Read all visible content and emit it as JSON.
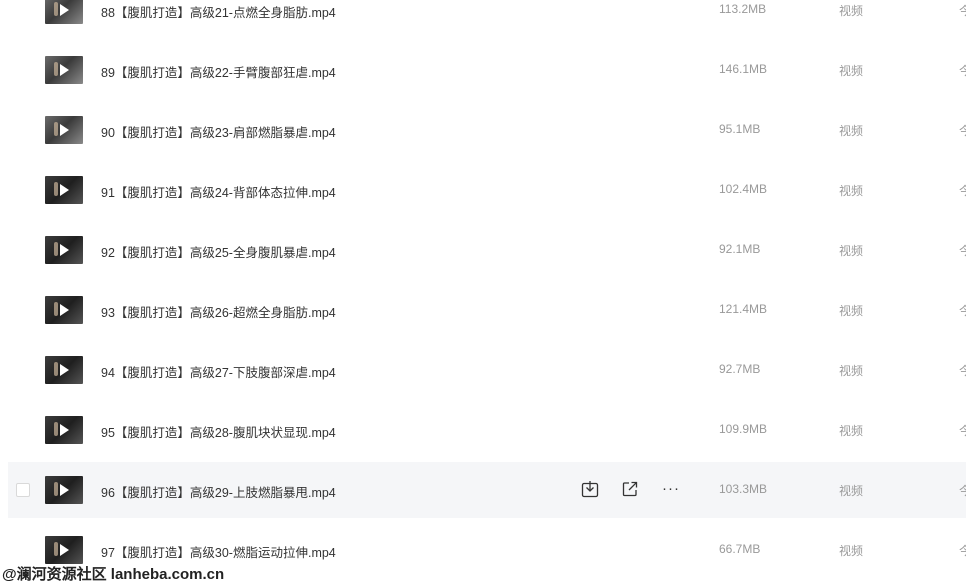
{
  "files": [
    {
      "name": "88【腹肌打造】高级21-点燃全身脂肪.mp4",
      "size": "113.2MB",
      "type": "视频",
      "date": "今",
      "thumb": "light"
    },
    {
      "name": "89【腹肌打造】高级22-手臂腹部狂虐.mp4",
      "size": "146.1MB",
      "type": "视频",
      "date": "今",
      "thumb": "light"
    },
    {
      "name": "90【腹肌打造】高级23-肩部燃脂暴虐.mp4",
      "size": "95.1MB",
      "type": "视频",
      "date": "今",
      "thumb": "light"
    },
    {
      "name": "91【腹肌打造】高级24-背部体态拉伸.mp4",
      "size": "102.4MB",
      "type": "视频",
      "date": "今",
      "thumb": "dark"
    },
    {
      "name": "92【腹肌打造】高级25-全身腹肌暴虐.mp4",
      "size": "92.1MB",
      "type": "视频",
      "date": "今",
      "thumb": "dark"
    },
    {
      "name": "93【腹肌打造】高级26-超燃全身脂肪.mp4",
      "size": "121.4MB",
      "type": "视频",
      "date": "今",
      "thumb": "dark"
    },
    {
      "name": "94【腹肌打造】高级27-下肢腹部深虐.mp4",
      "size": "92.7MB",
      "type": "视频",
      "date": "今",
      "thumb": "dark"
    },
    {
      "name": "95【腹肌打造】高级28-腹肌块状显现.mp4",
      "size": "109.9MB",
      "type": "视频",
      "date": "今",
      "thumb": "dark"
    },
    {
      "name": "96【腹肌打造】高级29-上肢燃脂暴甩.mp4",
      "size": "103.3MB",
      "type": "视频",
      "date": "今",
      "thumb": "dark",
      "hover": true
    },
    {
      "name": "97【腹肌打造】高级30-燃脂运动拉伸.mp4",
      "size": "66.7MB",
      "type": "视频",
      "date": "今",
      "thumb": "dark"
    }
  ],
  "row_actions": {
    "download_icon": "download-icon",
    "share_icon": "share-icon",
    "more_label": "···"
  },
  "watermark": "@澜河资源社区 lanheba.com.cn"
}
